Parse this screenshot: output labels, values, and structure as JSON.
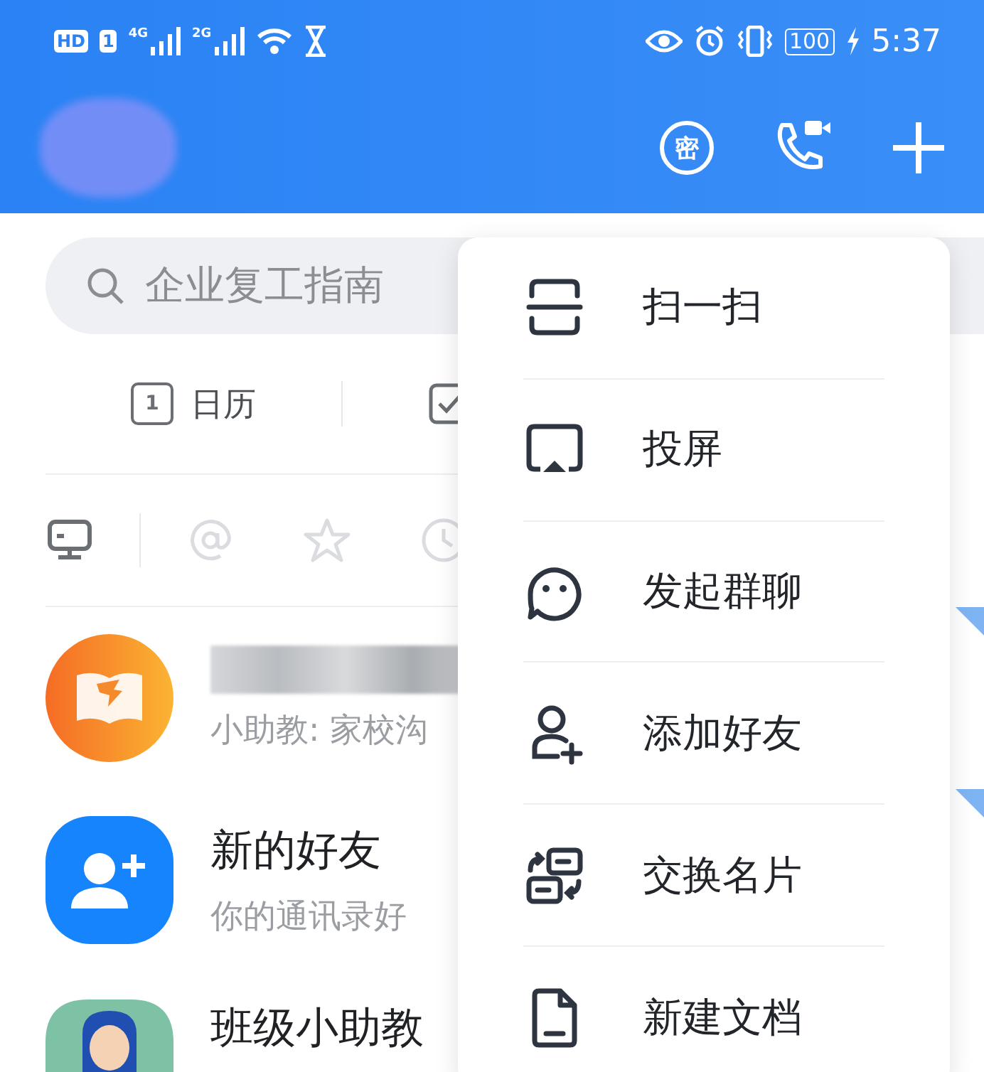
{
  "status_bar": {
    "sim_badges": [
      "HD",
      "1"
    ],
    "networks": [
      "4G",
      "2G"
    ],
    "battery": "100",
    "time": "5:37"
  },
  "header": {
    "secret_chat_glyph": "密"
  },
  "search": {
    "placeholder": "企业复工指南"
  },
  "shortcuts": [
    {
      "kind": "calendar",
      "icon_text": "1",
      "label": "日历"
    },
    {
      "kind": "todo"
    }
  ],
  "filters": [
    {
      "kind": "desktop",
      "selected": true
    },
    {
      "kind": "mention",
      "selected": false
    },
    {
      "kind": "star",
      "selected": false
    },
    {
      "kind": "clock",
      "selected": false
    }
  ],
  "conversations": [
    {
      "kind": "app",
      "title_redacted": true,
      "subtitle": "小助教: 家校沟",
      "unread": true
    },
    {
      "kind": "contacts",
      "title": "新的好友",
      "subtitle": "你的通讯录好",
      "unread": true
    },
    {
      "kind": "person",
      "title": "班级小助教",
      "unread": false
    }
  ],
  "menu": [
    {
      "kind": "scan",
      "label": "扫一扫"
    },
    {
      "kind": "cast",
      "label": "投屏"
    },
    {
      "kind": "group",
      "label": "发起群聊"
    },
    {
      "kind": "add",
      "label": "添加好友"
    },
    {
      "kind": "card",
      "label": "交换名片"
    },
    {
      "kind": "doc",
      "label": "新建文档"
    }
  ]
}
